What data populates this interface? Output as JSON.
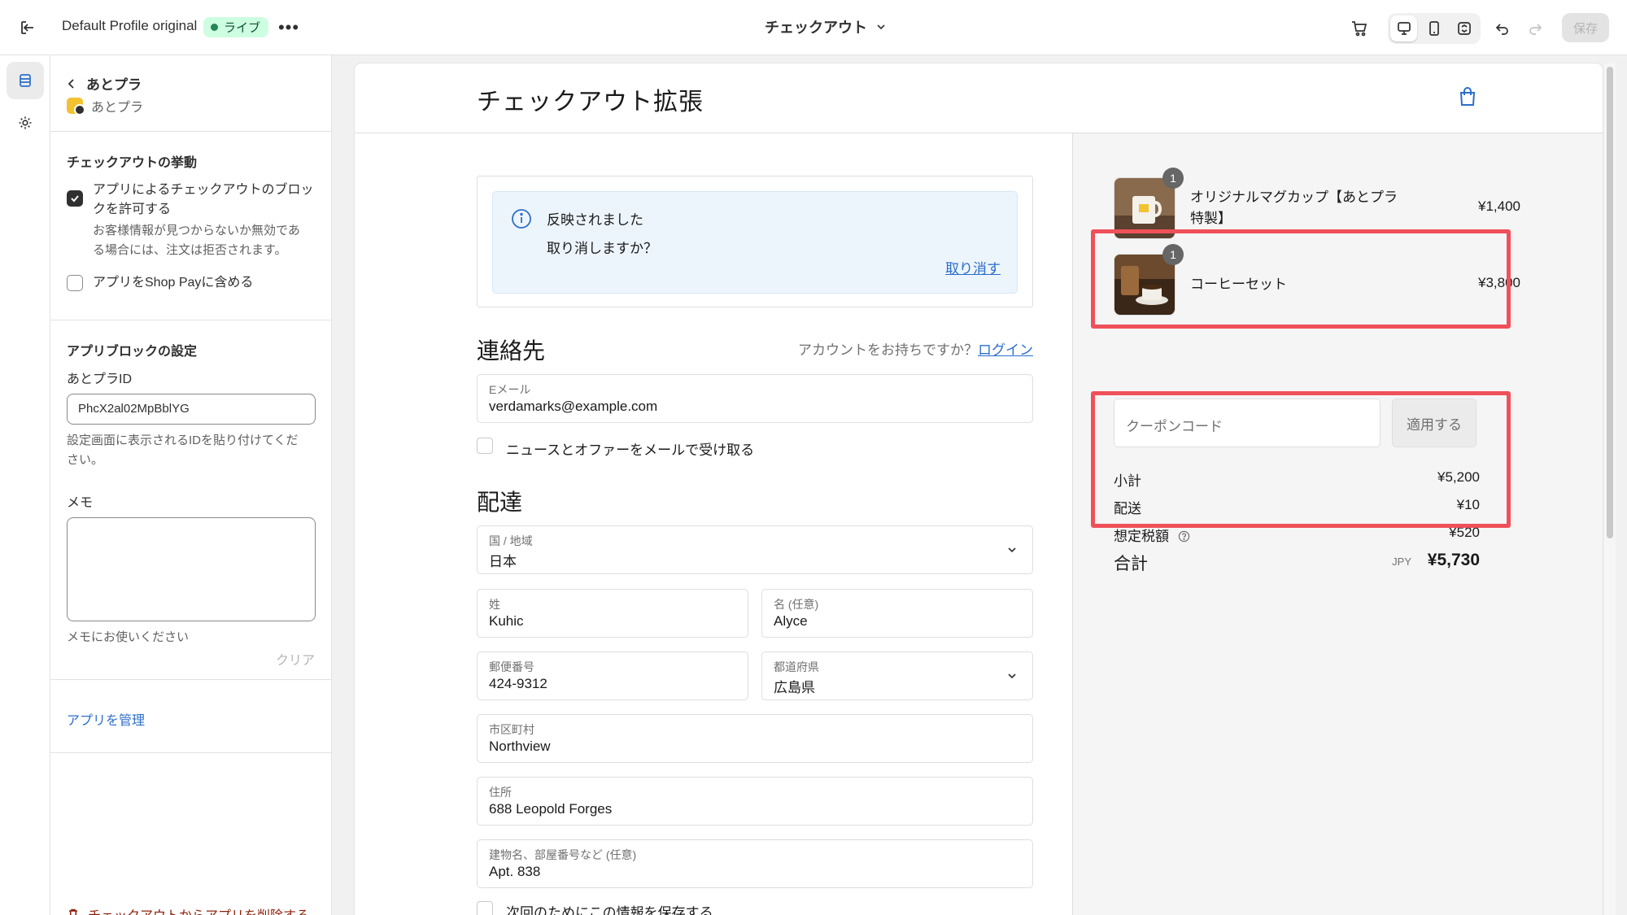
{
  "topbar": {
    "profile": "Default Profile original",
    "live_badge": "ライブ",
    "more": "•••",
    "page_selector": "チェックアウト",
    "save": "保存"
  },
  "panel": {
    "back_label": "あとプラ",
    "app_name": "あとプラ",
    "behavior": {
      "title": "チェックアウトの挙動",
      "allow_block_line1": "アプリによるチェックアウトのブロッ",
      "allow_block_line2": "クを許可する",
      "allow_block_help_line1": "お客様情報が見つからないか無効であ",
      "allow_block_help_line2": "る場合には、注文は拒否されます。",
      "allow_block_checked": true,
      "shop_pay": "アプリをShop Payに含める",
      "shop_pay_checked": false
    },
    "block_settings": {
      "title": "アプリブロックの設定",
      "id_label": "あとプラID",
      "id_value": "PhcX2al02MpBblYG",
      "id_help_line1": "設定画面に表示されるIDを貼り付けてくだ",
      "id_help_line2": "さい。",
      "memo_label": "メモ",
      "memo_value": "",
      "memo_help": "メモにお使いください",
      "clear": "クリア"
    },
    "manage_app": "アプリを管理",
    "remove_app": "チェックアウトからアプリを削除する"
  },
  "checkout": {
    "shop_title": "チェックアウト拡張",
    "banner": {
      "line1": "反映されました",
      "line2": "取り消しますか？",
      "undo": "取り消す"
    },
    "contact": {
      "heading": "連絡先",
      "account_hint": "アカウントをお持ちですか？",
      "login": "ログイン",
      "email_label": "Eメール",
      "email_value": "verdamarks@example.com",
      "newsletter": "ニュースとオファーをメールで受け取る"
    },
    "delivery": {
      "heading": "配達",
      "country_label": "国 / 地域",
      "country_value": "日本",
      "last_name_label": "姓",
      "last_name_value": "Kuhic",
      "first_name_label": "名 (任意)",
      "first_name_value": "Alyce",
      "postal_label": "郵便番号",
      "postal_value": "424-9312",
      "prefecture_label": "都道府県",
      "prefecture_value": "広島県",
      "city_label": "市区町村",
      "city_value": "Northview",
      "address_label": "住所",
      "address_value": "688 Leopold Forges",
      "apt_label": "建物名、部屋番号など (任意)",
      "apt_value": "Apt. 838",
      "save_info": "次回のためにこの情報を保存する"
    },
    "summary": {
      "items": [
        {
          "name_line1": "オリジナルマグカップ【あとプラ",
          "name_line2": "特製】",
          "price": "¥1,400",
          "qty": "1"
        },
        {
          "name_line1": "コーヒーセット",
          "name_line2": "",
          "price": "¥3,800",
          "qty": "1"
        }
      ],
      "coupon_placeholder": "クーポンコード",
      "apply": "適用する",
      "subtotal_label": "小計",
      "subtotal_value": "¥5,200",
      "shipping_label": "配送",
      "shipping_value": "¥10",
      "tax_label": "想定税額",
      "tax_value": "¥520",
      "total_label": "合計",
      "currency": "JPY",
      "total_value": "¥5,730"
    }
  },
  "colors": {
    "highlight": "#f0505a",
    "link": "#2c6ecb",
    "live_badge_bg": "#cdfee1"
  }
}
